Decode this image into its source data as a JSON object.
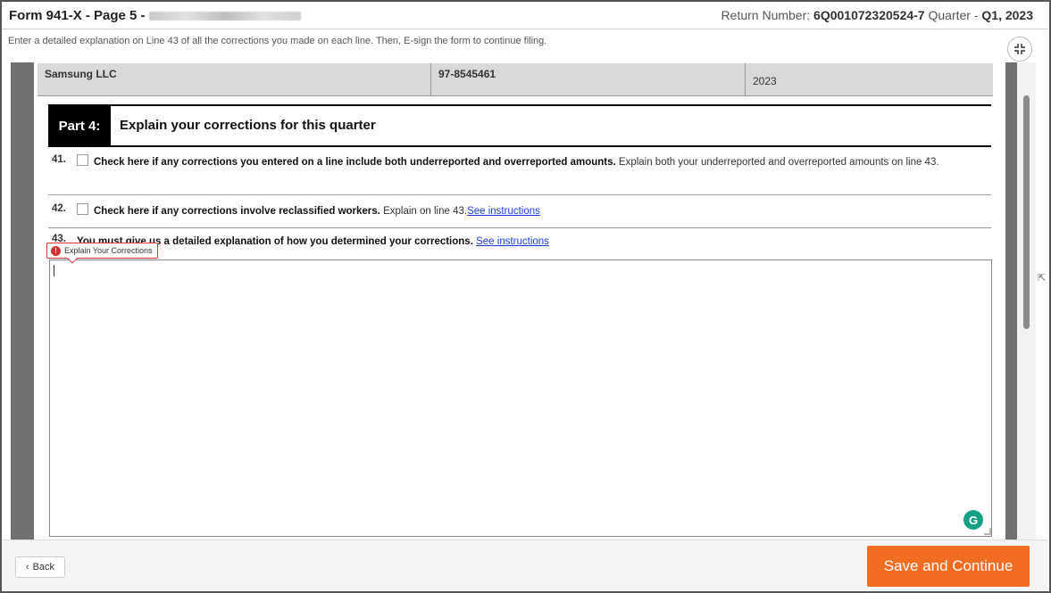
{
  "header": {
    "form_title": "Form 941-X - Page 5 -",
    "return_label": "Return Number:",
    "return_number": "6Q001072320524-7",
    "quarter_label": "Quarter -",
    "quarter_value": "Q1, 2023"
  },
  "instruction": "Enter a detailed explanation on Line 43 of all the corrections you made on each line. Then, E-sign the form to continue filing.",
  "company": {
    "name": "Samsung LLC",
    "ein": "97-8545461",
    "year": "2023"
  },
  "part4": {
    "label": "Part 4:",
    "title": "Explain your corrections for this quarter",
    "line41": {
      "number": "41.",
      "bold_text": "Check here if any corrections you entered on a line include both underreported and overreported amounts.",
      "text": " Explain both your underreported and overreported amounts on line 43."
    },
    "line42": {
      "number": "42.",
      "bold_text": "Check here if any corrections involve reclassified workers.",
      "text": " Explain on line 43.",
      "link": "See instructions"
    },
    "line43": {
      "number": "43.",
      "bold_text": "You must give us a detailed explanation of how you determined your corrections.",
      "link": "See instructions"
    },
    "tooltip": "Explain Your Corrections",
    "explanation_value": ""
  },
  "footer": {
    "back_label": "Back",
    "save_label": "Save and Continue"
  },
  "colors": {
    "accent": "#f26d22",
    "link": "#1a3fd6",
    "error": "#d32f2f",
    "grammarly": "#15a085"
  }
}
